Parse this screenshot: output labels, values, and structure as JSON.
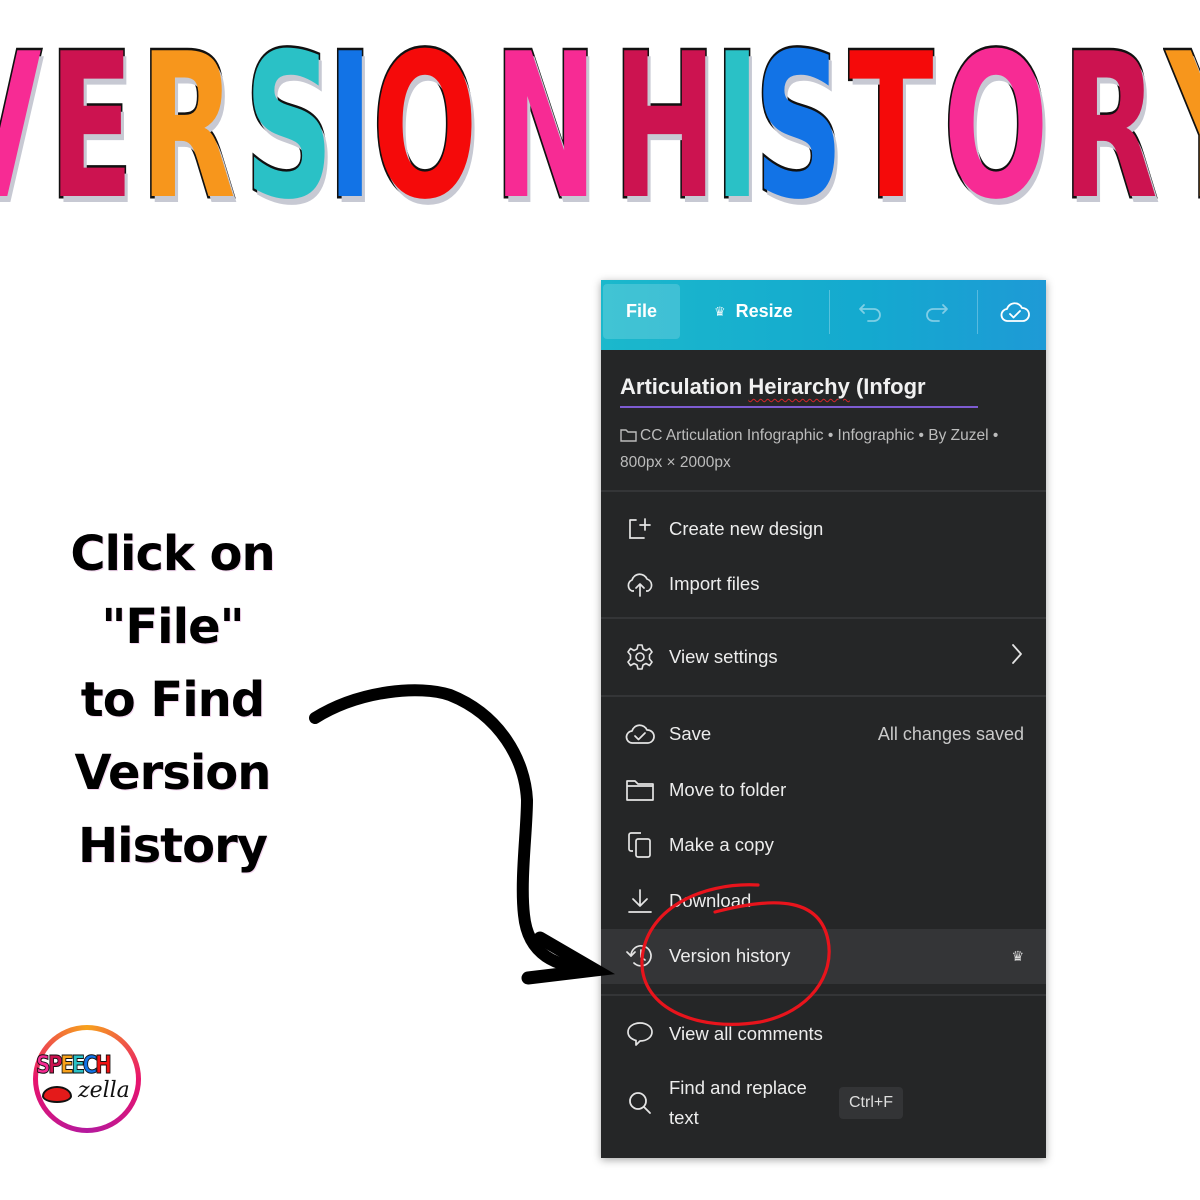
{
  "header": {
    "title_words": [
      {
        "letters": [
          {
            "char": "V",
            "color": "#f72b94"
          },
          {
            "char": "E",
            "color": "#cc1350"
          },
          {
            "char": "R",
            "color": "#f7961c"
          },
          {
            "char": "S",
            "color": "#2ac1c6"
          },
          {
            "char": "I",
            "color": "#1273e6"
          },
          {
            "char": "O",
            "color": "#f50a0a"
          },
          {
            "char": "N",
            "color": "#f72b94"
          }
        ]
      },
      {
        "letters": [
          {
            "char": "H",
            "color": "#cc1350"
          },
          {
            "char": "I",
            "color": "#2ac1c6"
          },
          {
            "char": "S",
            "color": "#1273e6"
          },
          {
            "char": "T",
            "color": "#f50a0a"
          },
          {
            "char": "O",
            "color": "#f72b94"
          },
          {
            "char": "R",
            "color": "#cc1350"
          },
          {
            "char": "Y",
            "color": "#f7961c"
          }
        ]
      }
    ]
  },
  "instruction": {
    "lines": [
      "Click on",
      "\"File\"",
      "to Find",
      "Version",
      "History"
    ]
  },
  "logo": {
    "letters": [
      "S",
      "P",
      "E",
      "E",
      "C",
      "H"
    ],
    "subtext": "zella"
  },
  "toolbar": {
    "file_label": "File",
    "resize_label": "Resize",
    "resize_icon": "crown-icon",
    "undo_icon": "undo-icon",
    "redo_icon": "redo-icon",
    "sync_icon": "cloud-check-icon",
    "accent_color": "#14a9cf"
  },
  "document": {
    "title_part1": "Articulation ",
    "title_misspelled": "Heirarchy",
    "title_part2": " (Infogr",
    "meta_line": "CC Articulation Infographic • Infographic • By Zuzel • 800px × 2000px"
  },
  "menu": {
    "sections": [
      {
        "items": [
          {
            "icon": "add-design-icon",
            "label": "Create new design"
          },
          {
            "icon": "cloud-upload-icon",
            "label": "Import files"
          }
        ]
      },
      {
        "items": [
          {
            "icon": "gear-icon",
            "label": "View settings",
            "right_icon": "chevron-right-icon"
          }
        ]
      },
      {
        "items": [
          {
            "icon": "cloud-check-icon",
            "label": "Save",
            "status": "All changes saved"
          },
          {
            "icon": "folder-icon",
            "label": "Move to folder"
          },
          {
            "icon": "copy-icon",
            "label": "Make a copy"
          },
          {
            "icon": "download-icon",
            "label": "Download"
          },
          {
            "icon": "history-icon",
            "label": "Version history",
            "badge": "crown-icon",
            "highlighted": true
          }
        ]
      },
      {
        "items": [
          {
            "icon": "comment-icon",
            "label": "View all comments"
          },
          {
            "icon": "search-icon",
            "label": "Find and replace text",
            "shortcut": "Ctrl+F"
          }
        ]
      }
    ]
  },
  "annotation": {
    "circle_color": "#e8141c",
    "arrow_color": "#000000"
  }
}
